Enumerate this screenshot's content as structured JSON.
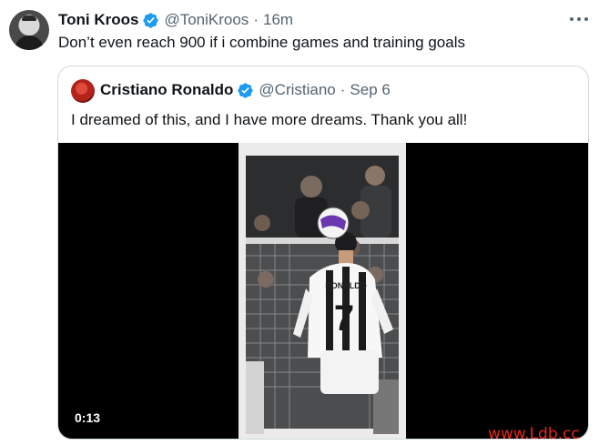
{
  "tweet": {
    "author_name": "Toni Kroos",
    "author_handle": "@ToniKroos",
    "separator": "·",
    "time": "16m",
    "text": "Don’t even reach 900 if i combine games and training goals"
  },
  "quote": {
    "author_name": "Cristiano Ronaldo",
    "author_handle": "@Cristiano",
    "separator": "·",
    "date": "Sep 6",
    "text": "I dreamed of this, and I have more dreams. Thank you all!",
    "video": {
      "duration": "0:13",
      "jersey_name": "RONALDO",
      "jersey_number": "7"
    }
  },
  "watermark": "www.Ldb.cc",
  "colors": {
    "verified": "#1d9bf0",
    "secondary_text": "#536471",
    "border": "#cfd9de",
    "watermark": "#e8261b"
  },
  "icons": {
    "verified": "verified-badge-icon",
    "more": "more-dots-icon"
  }
}
